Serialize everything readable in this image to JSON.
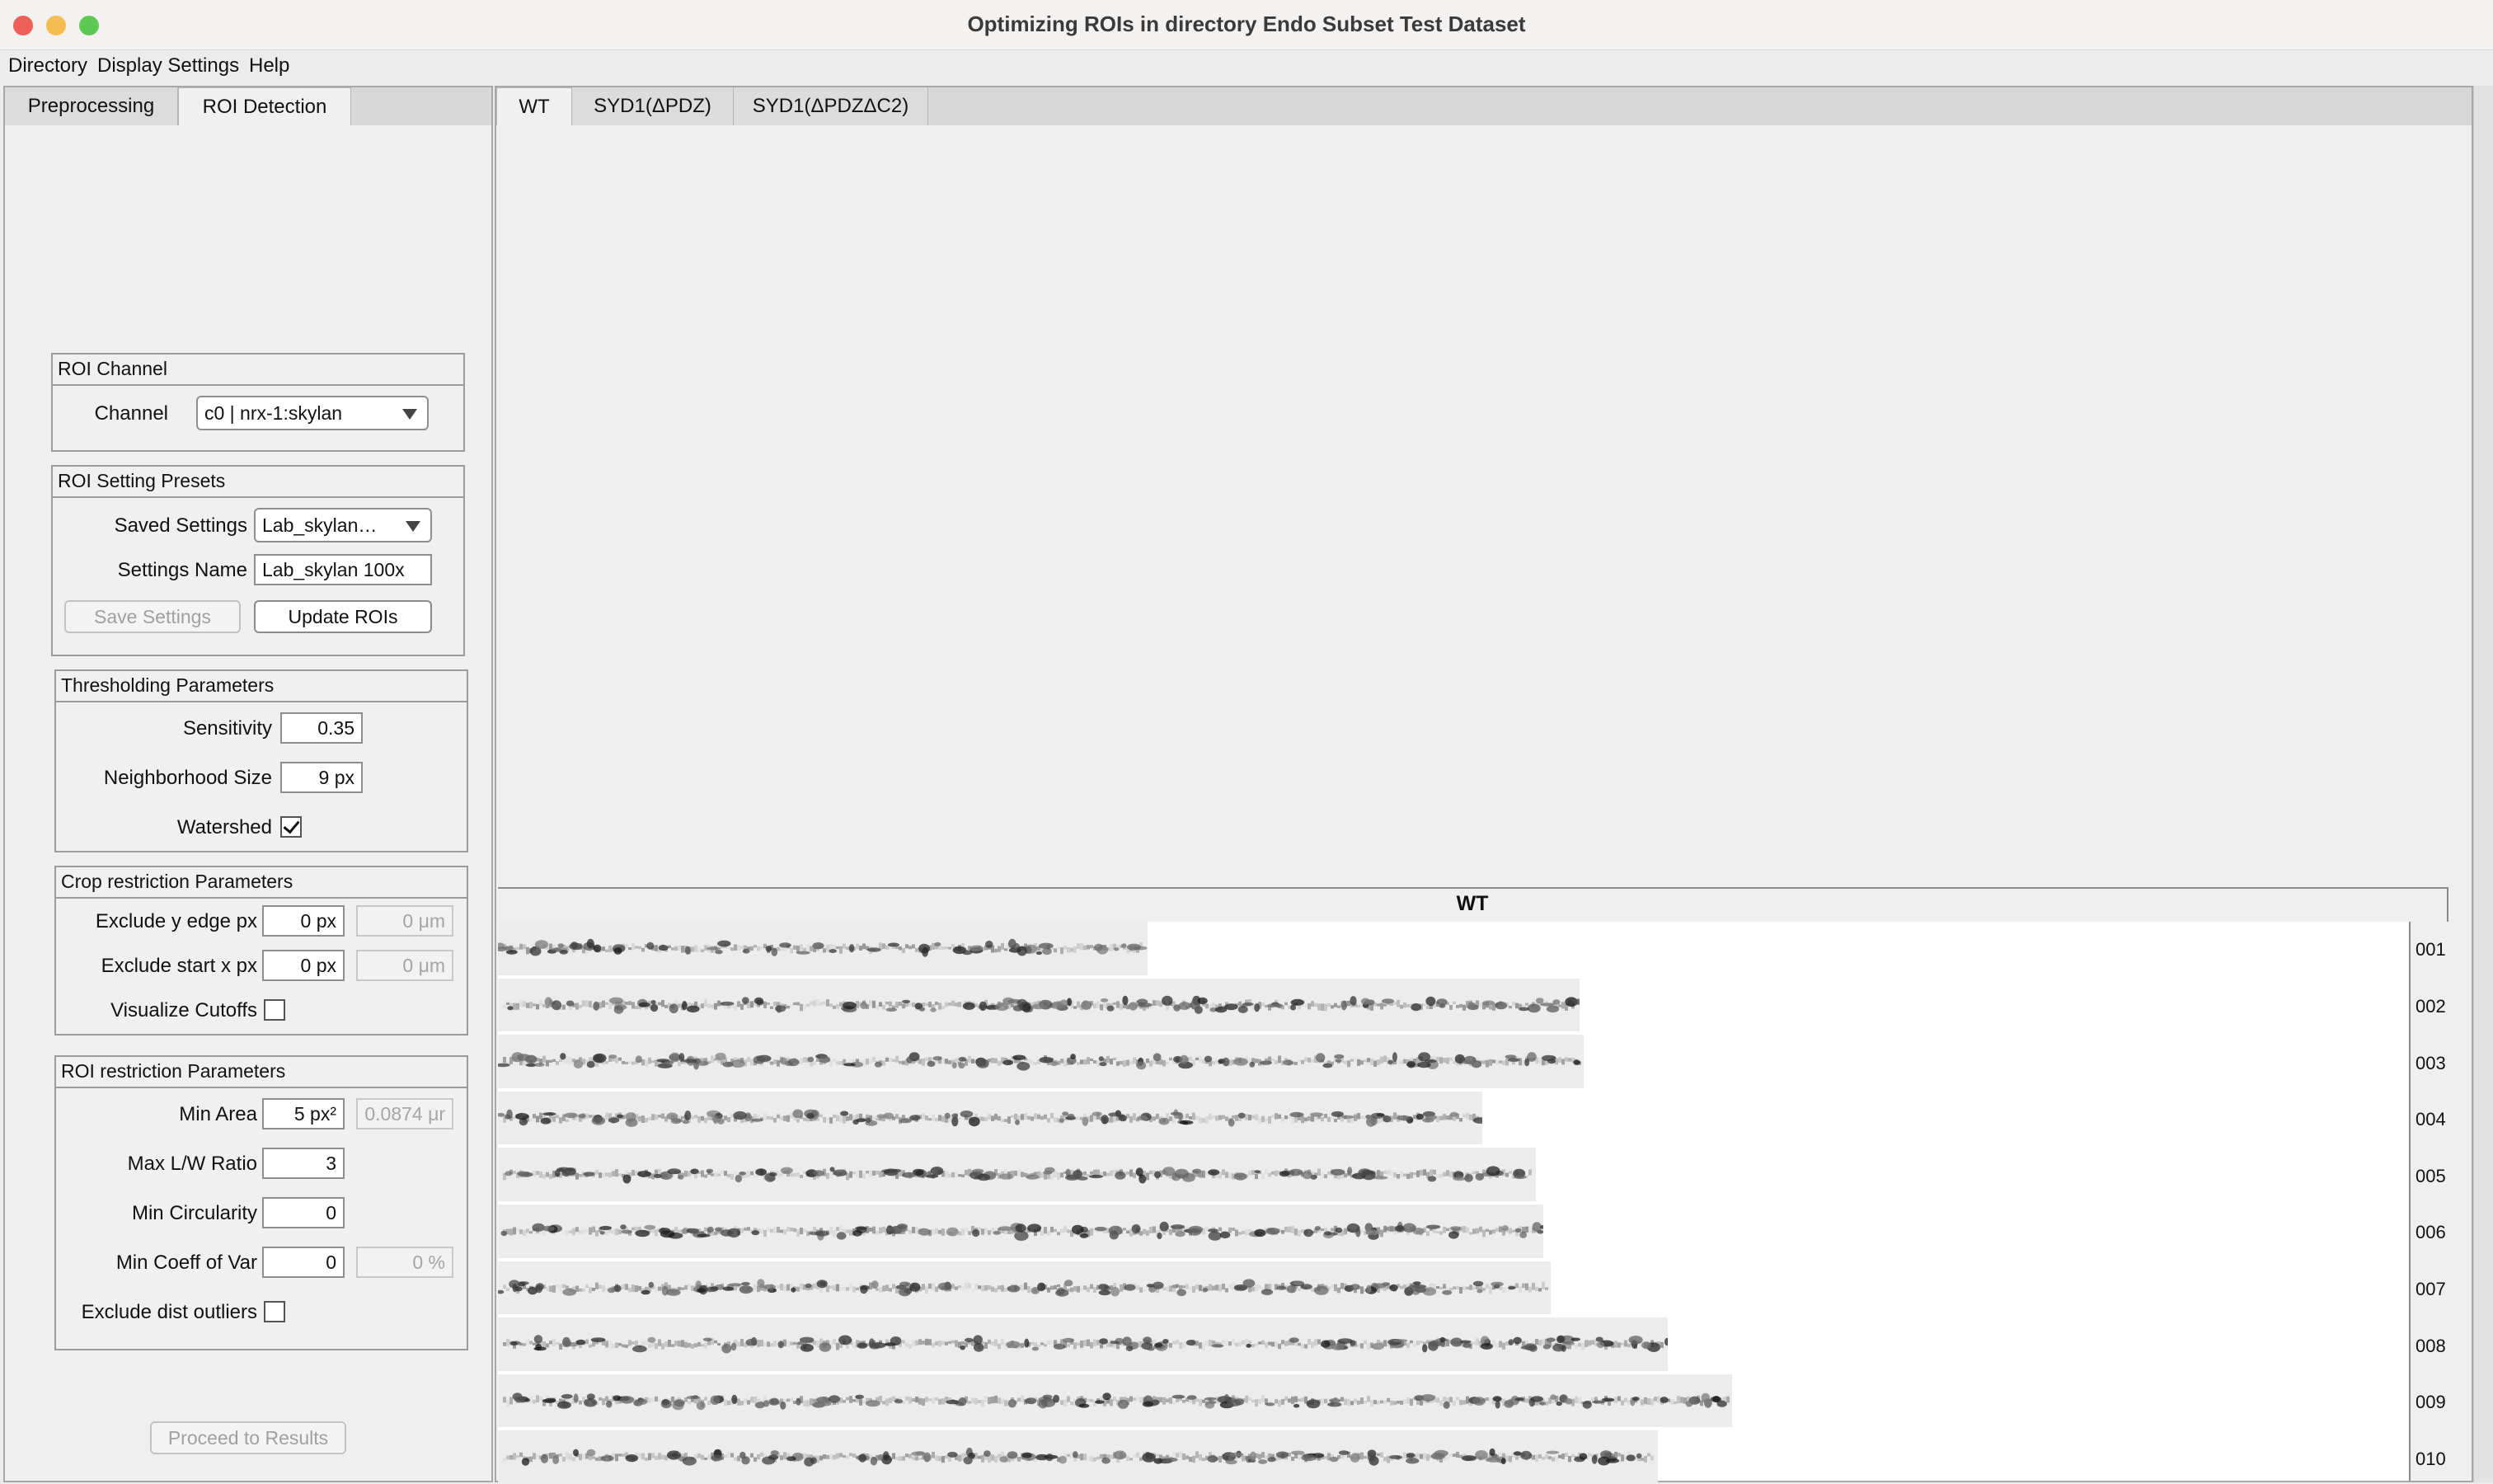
{
  "window": {
    "title": "Optimizing ROIs in directory Endo Subset Test Dataset",
    "traffic_light_colors": [
      "#ee5f57",
      "#f4bd4f",
      "#5fc854"
    ]
  },
  "menu": [
    "Directory",
    "Display Settings",
    "Help"
  ],
  "left_tabs": [
    {
      "label": "Preprocessing",
      "active": false
    },
    {
      "label": "ROI Detection",
      "active": true
    }
  ],
  "roi_channel": {
    "title": "ROI Channel",
    "channel_label": "Channel",
    "channel_value": "c0 | nrx-1:skylan"
  },
  "presets": {
    "title": "ROI Setting Presets",
    "saved_label": "Saved Settings",
    "saved_value": "Lab_skylan…",
    "name_label": "Settings Name",
    "name_value": "Lab_skylan 100x",
    "save_button": "Save Settings",
    "update_button": "Update ROIs"
  },
  "thresholding": {
    "title": "Thresholding Parameters",
    "sensitivity_label": "Sensitivity",
    "sensitivity_value": "0.35",
    "neighborhood_label": "Neighborhood Size",
    "neighborhood_value": "9 px",
    "watershed_label": "Watershed",
    "watershed_checked": true
  },
  "crop": {
    "title": "Crop restriction Parameters",
    "exclude_y_label": "Exclude y edge px",
    "exclude_y_px": "0 px",
    "exclude_y_um": "0 μm",
    "exclude_x_label": "Exclude start x px",
    "exclude_x_px": "0 px",
    "exclude_x_um": "0 μm",
    "visualize_label": "Visualize Cutoffs",
    "visualize_checked": false
  },
  "roi_restriction": {
    "title": "ROI restriction Parameters",
    "min_area_label": "Min Area",
    "min_area_px": "5 px²",
    "min_area_um": "0.0874 μr",
    "max_lw_label": "Max L/W Ratio",
    "max_lw_value": "3",
    "min_circ_label": "Min Circularity",
    "min_circ_value": "0",
    "min_cov_label": "Min Coeff of Var",
    "min_cov_value": "0",
    "min_cov_pct": "0 %",
    "exclude_outliers_label": "Exclude dist outliers",
    "exclude_outliers_checked": false
  },
  "proceed_button": "Proceed to Results",
  "right_tabs": [
    {
      "label": "WT",
      "active": true
    },
    {
      "label": "SYD1(ΔPDZ)",
      "active": false
    },
    {
      "label": "SYD1(ΔPDZΔC2)",
      "active": false
    }
  ],
  "figure": {
    "title": "WT",
    "rows": [
      {
        "label": "001",
        "length": 0.34
      },
      {
        "label": "002",
        "length": 0.566
      },
      {
        "label": "003",
        "length": 0.568
      },
      {
        "label": "004",
        "length": 0.515
      },
      {
        "label": "005",
        "length": 0.543
      },
      {
        "label": "006",
        "length": 0.547
      },
      {
        "label": "007",
        "length": 0.551
      },
      {
        "label": "008",
        "length": 0.612
      },
      {
        "label": "009",
        "length": 0.646
      },
      {
        "label": "010",
        "length": 0.607
      }
    ]
  }
}
